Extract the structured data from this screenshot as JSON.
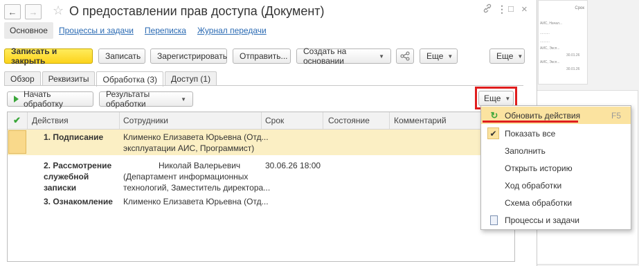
{
  "window": {
    "title": "О предоставлении прав доступа (Документ)",
    "nav_back": "←",
    "nav_forward": "→",
    "star": "☆",
    "link_icon": "link-icon",
    "menu_icon": "kebab-icon",
    "maximize": "□",
    "close": "×"
  },
  "nav_tabs": [
    "Основное",
    "Процессы и задачи",
    "Переписка",
    "Журнал передачи"
  ],
  "toolbar": {
    "save_close": "Записать и закрыть",
    "save": "Записать",
    "register": "Зарегистрировать",
    "send": "Отправить...",
    "create_basis": "Создать на основании",
    "share_icon": "share-icon",
    "more1": "Еще",
    "more2": "Еще"
  },
  "tabs": [
    "Обзор",
    "Реквизиты",
    "Обработка (3)",
    "Доступ (1)"
  ],
  "subtoolbar": {
    "start": "Начать обработку",
    "results": "Результаты обработки",
    "more": "Еще"
  },
  "grid": {
    "columns": [
      "Действия",
      "Сотрудники",
      "Срок",
      "Состояние",
      "Комментарий"
    ],
    "rows": [
      {
        "action": "1. Подписание",
        "emp1": "Клименко Елизавета Юрьевна (Отд...",
        "emp2": "эксплуатации АИС, Программист)",
        "emp3": "",
        "term": ""
      },
      {
        "action1": "2. Рассмотрение",
        "action2": "служебной",
        "action3": "записки",
        "emp1": "Николай Валерьевич",
        "emp2": "(Департамент информационных",
        "emp3": "технологий, Заместитель директора...",
        "term": "30.06.26 18:00"
      },
      {
        "action": "3. Ознакомление",
        "emp1": "Клименко Елизавета Юрьевна (Отд...",
        "term": ""
      }
    ]
  },
  "menu": {
    "items": [
      {
        "label": "Обновить действия",
        "shortcut": "F5"
      },
      {
        "label": "Показать все"
      },
      {
        "label": "Заполнить"
      },
      {
        "label": "Открыть историю"
      },
      {
        "label": "Ход обработки"
      },
      {
        "label": "Схема обработки"
      },
      {
        "label": "Процессы и задачи"
      }
    ]
  },
  "background": {
    "col_header": "Срок",
    "lines": [
      "АИС, Начал...",
      "..........",
      "..........",
      "АИС, Эксп...",
      "..........",
      "АИС, Эксп...",
      ".........."
    ],
    "dates": [
      "30.01.26",
      "30.01.26"
    ]
  },
  "colors": {
    "accent_yellow": "#fcd31c",
    "link_blue": "#2a6ab3",
    "highlight_red": "#e01e1e",
    "row_selected": "#fbefc4",
    "green": "#3aa63a"
  }
}
